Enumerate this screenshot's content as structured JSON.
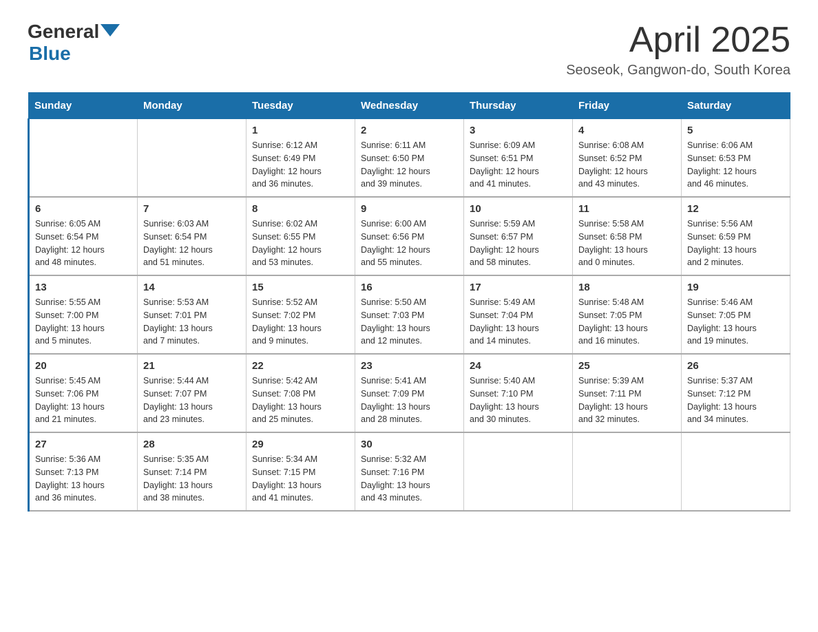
{
  "header": {
    "logo_general": "General",
    "logo_blue": "Blue",
    "title": "April 2025",
    "subtitle": "Seoseok, Gangwon-do, South Korea"
  },
  "days_of_week": [
    "Sunday",
    "Monday",
    "Tuesday",
    "Wednesday",
    "Thursday",
    "Friday",
    "Saturday"
  ],
  "weeks": [
    [
      {
        "day": "",
        "info": ""
      },
      {
        "day": "",
        "info": ""
      },
      {
        "day": "1",
        "info": "Sunrise: 6:12 AM\nSunset: 6:49 PM\nDaylight: 12 hours\nand 36 minutes."
      },
      {
        "day": "2",
        "info": "Sunrise: 6:11 AM\nSunset: 6:50 PM\nDaylight: 12 hours\nand 39 minutes."
      },
      {
        "day": "3",
        "info": "Sunrise: 6:09 AM\nSunset: 6:51 PM\nDaylight: 12 hours\nand 41 minutes."
      },
      {
        "day": "4",
        "info": "Sunrise: 6:08 AM\nSunset: 6:52 PM\nDaylight: 12 hours\nand 43 minutes."
      },
      {
        "day": "5",
        "info": "Sunrise: 6:06 AM\nSunset: 6:53 PM\nDaylight: 12 hours\nand 46 minutes."
      }
    ],
    [
      {
        "day": "6",
        "info": "Sunrise: 6:05 AM\nSunset: 6:54 PM\nDaylight: 12 hours\nand 48 minutes."
      },
      {
        "day": "7",
        "info": "Sunrise: 6:03 AM\nSunset: 6:54 PM\nDaylight: 12 hours\nand 51 minutes."
      },
      {
        "day": "8",
        "info": "Sunrise: 6:02 AM\nSunset: 6:55 PM\nDaylight: 12 hours\nand 53 minutes."
      },
      {
        "day": "9",
        "info": "Sunrise: 6:00 AM\nSunset: 6:56 PM\nDaylight: 12 hours\nand 55 minutes."
      },
      {
        "day": "10",
        "info": "Sunrise: 5:59 AM\nSunset: 6:57 PM\nDaylight: 12 hours\nand 58 minutes."
      },
      {
        "day": "11",
        "info": "Sunrise: 5:58 AM\nSunset: 6:58 PM\nDaylight: 13 hours\nand 0 minutes."
      },
      {
        "day": "12",
        "info": "Sunrise: 5:56 AM\nSunset: 6:59 PM\nDaylight: 13 hours\nand 2 minutes."
      }
    ],
    [
      {
        "day": "13",
        "info": "Sunrise: 5:55 AM\nSunset: 7:00 PM\nDaylight: 13 hours\nand 5 minutes."
      },
      {
        "day": "14",
        "info": "Sunrise: 5:53 AM\nSunset: 7:01 PM\nDaylight: 13 hours\nand 7 minutes."
      },
      {
        "day": "15",
        "info": "Sunrise: 5:52 AM\nSunset: 7:02 PM\nDaylight: 13 hours\nand 9 minutes."
      },
      {
        "day": "16",
        "info": "Sunrise: 5:50 AM\nSunset: 7:03 PM\nDaylight: 13 hours\nand 12 minutes."
      },
      {
        "day": "17",
        "info": "Sunrise: 5:49 AM\nSunset: 7:04 PM\nDaylight: 13 hours\nand 14 minutes."
      },
      {
        "day": "18",
        "info": "Sunrise: 5:48 AM\nSunset: 7:05 PM\nDaylight: 13 hours\nand 16 minutes."
      },
      {
        "day": "19",
        "info": "Sunrise: 5:46 AM\nSunset: 7:05 PM\nDaylight: 13 hours\nand 19 minutes."
      }
    ],
    [
      {
        "day": "20",
        "info": "Sunrise: 5:45 AM\nSunset: 7:06 PM\nDaylight: 13 hours\nand 21 minutes."
      },
      {
        "day": "21",
        "info": "Sunrise: 5:44 AM\nSunset: 7:07 PM\nDaylight: 13 hours\nand 23 minutes."
      },
      {
        "day": "22",
        "info": "Sunrise: 5:42 AM\nSunset: 7:08 PM\nDaylight: 13 hours\nand 25 minutes."
      },
      {
        "day": "23",
        "info": "Sunrise: 5:41 AM\nSunset: 7:09 PM\nDaylight: 13 hours\nand 28 minutes."
      },
      {
        "day": "24",
        "info": "Sunrise: 5:40 AM\nSunset: 7:10 PM\nDaylight: 13 hours\nand 30 minutes."
      },
      {
        "day": "25",
        "info": "Sunrise: 5:39 AM\nSunset: 7:11 PM\nDaylight: 13 hours\nand 32 minutes."
      },
      {
        "day": "26",
        "info": "Sunrise: 5:37 AM\nSunset: 7:12 PM\nDaylight: 13 hours\nand 34 minutes."
      }
    ],
    [
      {
        "day": "27",
        "info": "Sunrise: 5:36 AM\nSunset: 7:13 PM\nDaylight: 13 hours\nand 36 minutes."
      },
      {
        "day": "28",
        "info": "Sunrise: 5:35 AM\nSunset: 7:14 PM\nDaylight: 13 hours\nand 38 minutes."
      },
      {
        "day": "29",
        "info": "Sunrise: 5:34 AM\nSunset: 7:15 PM\nDaylight: 13 hours\nand 41 minutes."
      },
      {
        "day": "30",
        "info": "Sunrise: 5:32 AM\nSunset: 7:16 PM\nDaylight: 13 hours\nand 43 minutes."
      },
      {
        "day": "",
        "info": ""
      },
      {
        "day": "",
        "info": ""
      },
      {
        "day": "",
        "info": ""
      }
    ]
  ]
}
